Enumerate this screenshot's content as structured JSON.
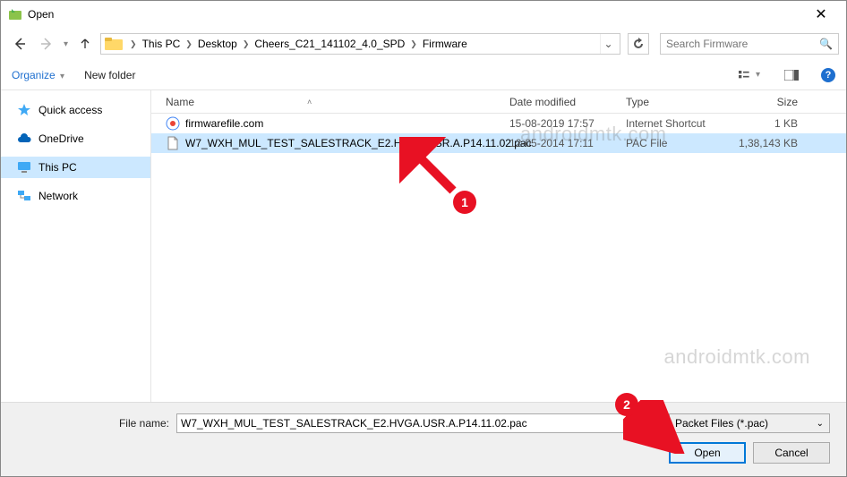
{
  "window": {
    "title": "Open"
  },
  "breadcrumb": {
    "root": "This PC",
    "seg1": "Desktop",
    "seg2": "Cheers_C21_141102_4.0_SPD",
    "seg3": "Firmware"
  },
  "search": {
    "placeholder": "Search Firmware"
  },
  "toolbar": {
    "organize": "Organize",
    "newfolder": "New folder"
  },
  "sidebar": {
    "items": [
      {
        "label": "Quick access"
      },
      {
        "label": "OneDrive"
      },
      {
        "label": "This PC"
      },
      {
        "label": "Network"
      }
    ]
  },
  "columns": {
    "name": "Name",
    "date": "Date modified",
    "type": "Type",
    "size": "Size"
  },
  "files": [
    {
      "name": "firmwarefile.com",
      "date": "15-08-2019 17:57",
      "type": "Internet Shortcut",
      "size": "1 KB"
    },
    {
      "name": "W7_WXH_MUL_TEST_SALESTRACK_E2.HVGA.USR.A.P14.11.02.pac",
      "date": "12-05-2014 17:11",
      "type": "PAC File",
      "size": "1,38,143 KB"
    }
  ],
  "filename": {
    "label": "File name:",
    "value": "W7_WXH_MUL_TEST_SALESTRACK_E2.HVGA.USR.A.P14.11.02.pac"
  },
  "filter": {
    "label": "Packet Files (*.pac)"
  },
  "buttons": {
    "open": "Open",
    "cancel": "Cancel"
  },
  "watermark": "androidmtk.com",
  "callouts": {
    "one": "1",
    "two": "2"
  }
}
